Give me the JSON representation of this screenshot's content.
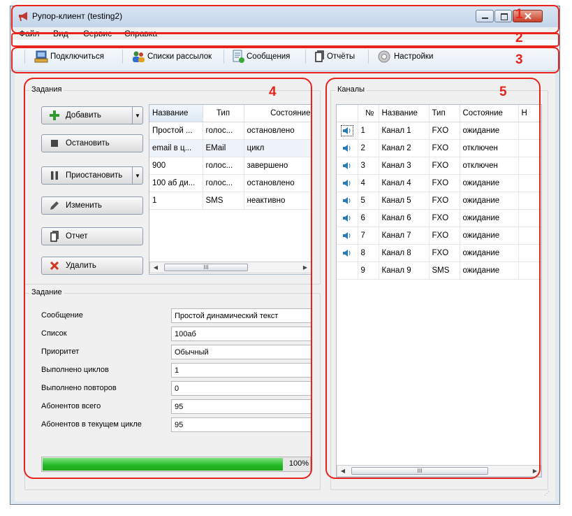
{
  "window": {
    "title": "Рупор-клиент (testing2)"
  },
  "menu": [
    "Файл",
    "Вид",
    "Сервис",
    "Справка"
  ],
  "toolbar": {
    "connect": "Подключиться",
    "mailing_lists": "Списки рассылок",
    "messages": "Сообщения",
    "reports": "Отчёты",
    "settings": "Настройки"
  },
  "tasks": {
    "group_title": "Задания",
    "buttons": {
      "add": "Добавить",
      "stop": "Остановить",
      "pause": "Приостановить",
      "edit": "Изменить",
      "report": "Отчет",
      "delete": "Удалить"
    },
    "columns": [
      "Название",
      "Тип",
      "Состояние"
    ],
    "rows": [
      [
        "Простой ...",
        "голос...",
        "остановлено"
      ],
      [
        "email в ц...",
        "EMail",
        "цикл"
      ],
      [
        "900",
        "голос...",
        "завершено"
      ],
      [
        "100 аб ди...",
        "голос...",
        "остановлено"
      ],
      [
        "1",
        "SMS",
        "неактивно"
      ]
    ],
    "scroll_thumb": "III"
  },
  "task_details": {
    "group_title": "Задание",
    "fields": [
      {
        "label": "Сообщение",
        "value": "Простой динамический текст"
      },
      {
        "label": "Список",
        "value": "100аб"
      },
      {
        "label": "Приоритет",
        "value": "Обычный"
      },
      {
        "label": "Выполнено циклов",
        "value": "1"
      },
      {
        "label": "Выполнено повторов",
        "value": "0"
      },
      {
        "label": "Абонентов всего",
        "value": "95"
      },
      {
        "label": "Абонентов в текущем цикле",
        "value": "95"
      }
    ],
    "progress": {
      "percent": 100,
      "label": "100%"
    }
  },
  "channels": {
    "group_title": "Каналы",
    "columns": [
      "",
      "№",
      "Название",
      "Тип",
      "Состояние",
      "Н"
    ],
    "rows": [
      {
        "speaker": true,
        "num": "1",
        "name": "Канал 1",
        "type": "FXO",
        "state": "ожидание"
      },
      {
        "speaker": true,
        "num": "2",
        "name": "Канал 2",
        "type": "FXO",
        "state": "отключен"
      },
      {
        "speaker": true,
        "num": "3",
        "name": "Канал 3",
        "type": "FXO",
        "state": "отключен"
      },
      {
        "speaker": true,
        "num": "4",
        "name": "Канал 4",
        "type": "FXO",
        "state": "ожидание"
      },
      {
        "speaker": true,
        "num": "5",
        "name": "Канал 5",
        "type": "FXO",
        "state": "ожидание"
      },
      {
        "speaker": true,
        "num": "6",
        "name": "Канал 6",
        "type": "FXO",
        "state": "ожидание"
      },
      {
        "speaker": true,
        "num": "7",
        "name": "Канал 7",
        "type": "FXO",
        "state": "ожидание"
      },
      {
        "speaker": true,
        "num": "8",
        "name": "Канал 8",
        "type": "FXO",
        "state": "ожидание"
      },
      {
        "speaker": false,
        "num": "9",
        "name": "Канал 9",
        "type": "SMS",
        "state": "ожидание"
      }
    ],
    "scroll_thumb": "III"
  },
  "annotations": [
    "1",
    "2",
    "3",
    "4",
    "5"
  ],
  "colors": {
    "annotation": "#e8231c",
    "progress": "#2fc82f",
    "selected_row": "#eef3f9"
  },
  "icons": {
    "title": "megaphone-icon",
    "connect": "computer-connect-icon",
    "mailing_lists": "people-icon",
    "messages": "document-icon",
    "reports": "report-icon",
    "settings": "gear-icon",
    "add": "plus-icon",
    "stop": "stop-icon",
    "pause": "pause-icon",
    "edit": "pencil-icon",
    "report": "report-icon",
    "delete": "delete-x-icon",
    "channel": "speaker-icon"
  }
}
